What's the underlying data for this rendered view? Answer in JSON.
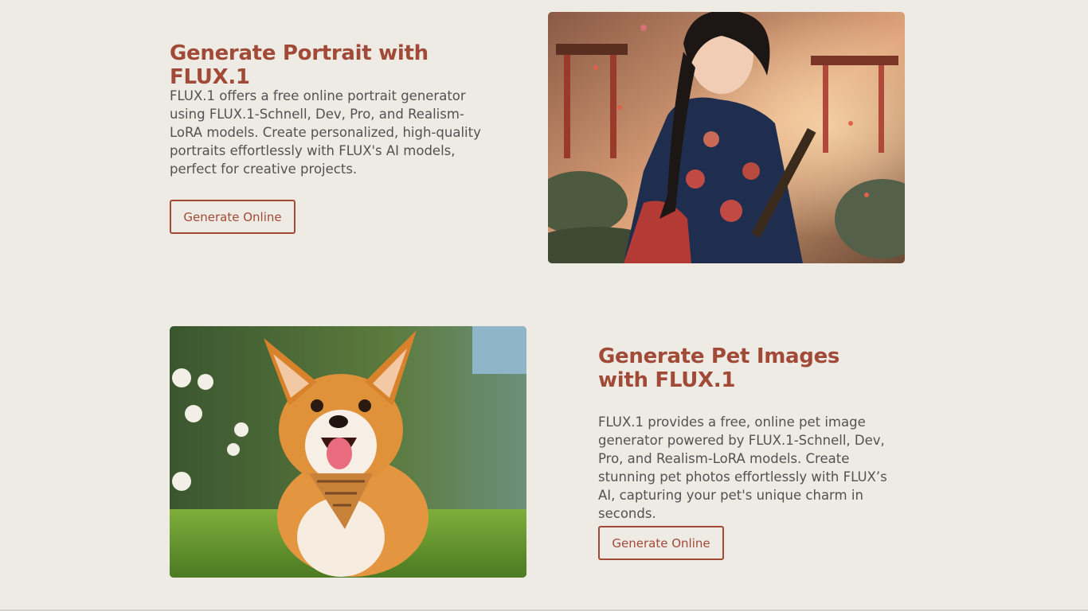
{
  "portrait_section": {
    "title": "Generate Portrait with FLUX.1",
    "description": "FLUX.1 offers a free online portrait generator using FLUX.1-Schnell, Dev, Pro, and Realism-LoRA models. Create personalized, high-quality portraits effortlessly with FLUX's AI models, perfect for creative projects.",
    "button_label": "Generate Online"
  },
  "pet_section": {
    "title": "Generate Pet Images with FLUX.1",
    "description": "FLUX.1 provides a free, online pet image generator powered by FLUX.1-Schnell, Dev, Pro, and Realism-LoRA models. Create stunning pet photos effortlessly with FLUX’s AI, capturing your pet's unique charm in seconds.",
    "button_label": "Generate Online"
  },
  "colors": {
    "background": "#edebe4",
    "accent": "#a24a38",
    "body_text": "#525252"
  }
}
